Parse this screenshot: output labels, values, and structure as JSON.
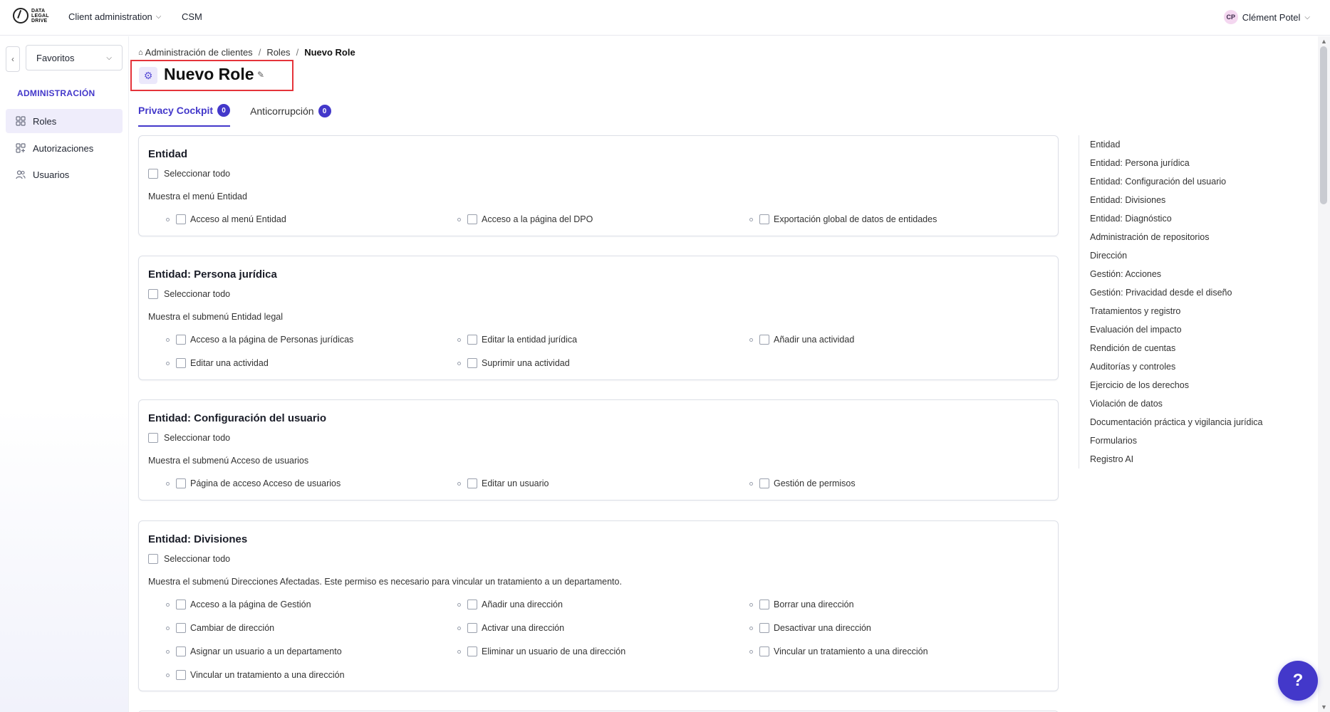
{
  "topbar": {
    "logo_text": [
      "DATA",
      "LEGAL",
      "DRIVE"
    ],
    "menu_label": "Client administration",
    "csm_label": "CSM",
    "user_initials": "CP",
    "user_name": "Clément Potel"
  },
  "sidebar": {
    "favorites_label": "Favoritos",
    "section_title": "ADMINISTRACIÓN",
    "items": [
      {
        "label": "Roles",
        "icon": "grid-icon",
        "active": true
      },
      {
        "label": "Autorizaciones",
        "icon": "apps-add-icon",
        "active": false
      },
      {
        "label": "Usuarios",
        "icon": "users-icon",
        "active": false
      }
    ]
  },
  "breadcrumb": {
    "items": [
      "Administración de clientes",
      "Roles",
      "Nuevo Role"
    ]
  },
  "page": {
    "title": "Nuevo Role"
  },
  "tabs": [
    {
      "label": "Privacy Cockpit",
      "count": "0",
      "active": true
    },
    {
      "label": "Anticorrupción",
      "count": "0",
      "active": false
    }
  ],
  "cards": [
    {
      "title": "Entidad",
      "select_all": "Seleccionar todo",
      "description": "Muestra el menú Entidad",
      "permissions": [
        "Acceso al menú Entidad",
        "Acceso a la página del DPO",
        "Exportación global de datos de entidades"
      ]
    },
    {
      "title": "Entidad: Persona jurídica",
      "select_all": "Seleccionar todo",
      "description": "Muestra el submenú Entidad legal",
      "permissions": [
        "Acceso a la página de Personas jurídicas",
        "Editar la entidad jurídica",
        "Añadir una actividad",
        "Editar una actividad",
        "Suprimir una actividad"
      ]
    },
    {
      "title": "Entidad: Configuración del usuario",
      "select_all": "Seleccionar todo",
      "description": "Muestra el submenú Acceso de usuarios",
      "permissions": [
        "Página de acceso Acceso de usuarios",
        "Editar un usuario",
        "Gestión de permisos"
      ]
    },
    {
      "title": "Entidad: Divisiones",
      "select_all": "Seleccionar todo",
      "description": "Muestra el submenú Direcciones Afectadas. Este permiso es necesario para vincular un tratamiento a un departamento.",
      "permissions": [
        "Acceso a la página de Gestión",
        "Añadir una dirección",
        "Borrar una dirección",
        "Cambiar de dirección",
        "Activar una dirección",
        "Desactivar una dirección",
        "Asignar un usuario a un departamento",
        "Eliminar un usuario de una dirección",
        "Vincular un tratamiento a una dirección",
        "Vincular un tratamiento a una dirección"
      ]
    }
  ],
  "toc": [
    "Entidad",
    "Entidad: Persona jurídica",
    "Entidad: Configuración del usuario",
    "Entidad: Divisiones",
    "Entidad: Diagnóstico",
    "Administración de repositorios",
    "Dirección",
    "Gestión: Acciones",
    "Gestión: Privacidad desde el diseño",
    "Tratamientos y registro",
    "Evaluación del impacto",
    "Rendición de cuentas",
    "Auditorías y controles",
    "Ejercicio de los derechos",
    "Violación de datos",
    "Documentación práctica y vigilancia jurídica",
    "Formularios",
    "Registro AI"
  ],
  "colors": {
    "accent": "#4338ca",
    "highlight_border": "#e5343a",
    "active_nav_bg": "#efedfb"
  }
}
